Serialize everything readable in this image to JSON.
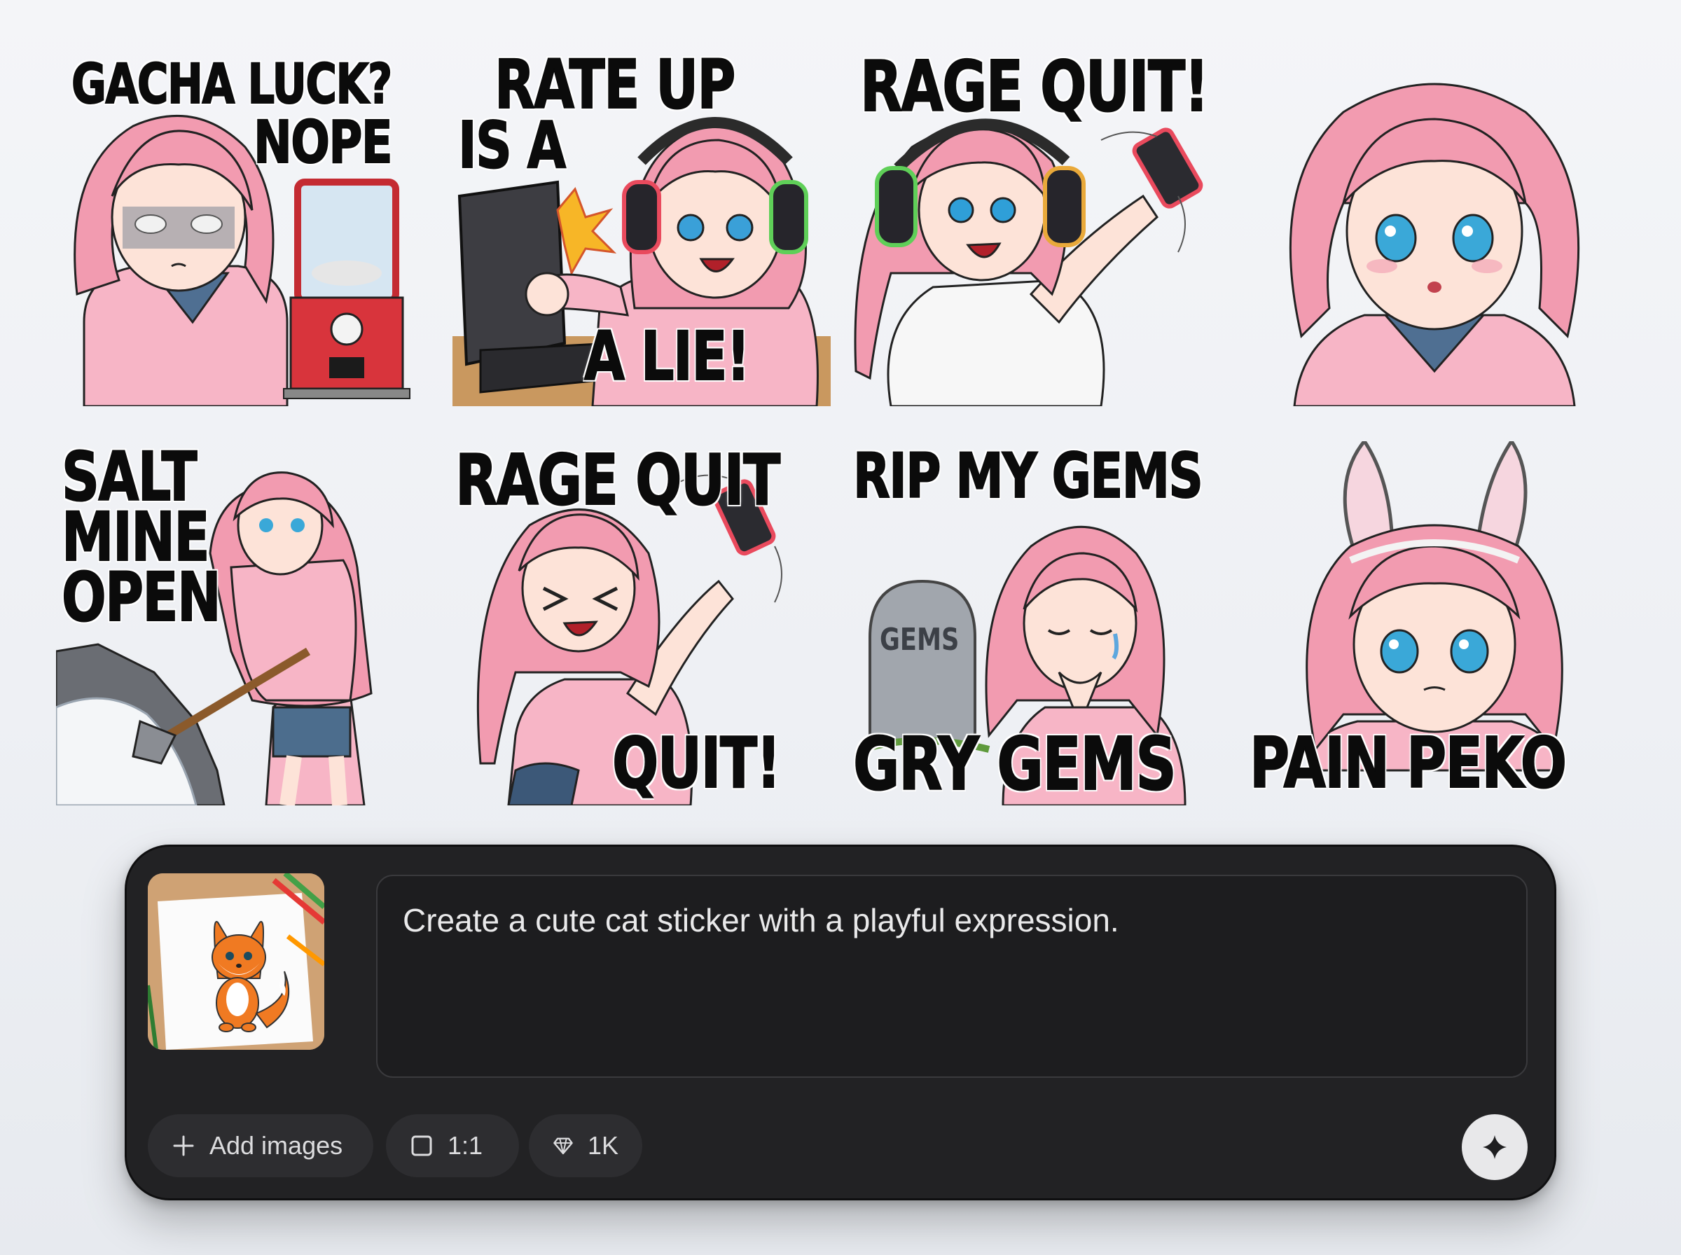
{
  "stickers": [
    {
      "caption_top": "GACHA LUCK?",
      "caption_mid": "NOPE"
    },
    {
      "caption_top": "RATE UP",
      "caption_mid": "IS A",
      "caption_bottom": "A LIE!"
    },
    {
      "caption_top": "RAGE QUIT!"
    },
    {},
    {
      "caption_top": "SALT",
      "caption_mid": "MINE",
      "caption_bottom": "OPEN"
    },
    {
      "caption_top": "RAGE QUIT",
      "caption_bottom": "QUIT!"
    },
    {
      "caption_top": "RIP MY GEMS",
      "caption_bottom": "GRY GEMS",
      "tombstone_label": "GEMS"
    },
    {
      "caption_bottom": "PAIN PEKO"
    }
  ],
  "composer": {
    "prompt_text": "Create a cute cat sticker with a playful expression.",
    "add_images_label": "Add images",
    "aspect_ratio_label": "1:1",
    "resolution_label": "1K"
  },
  "icons": {
    "add": "plus-icon",
    "aspect": "square-icon",
    "resolution": "diamond-icon",
    "send": "sparkle-icon"
  },
  "colors": {
    "hair": "#f29bb0",
    "hoodie": "#f7b5c6",
    "panel": "#222224",
    "send_button": "#e8e8ea"
  }
}
